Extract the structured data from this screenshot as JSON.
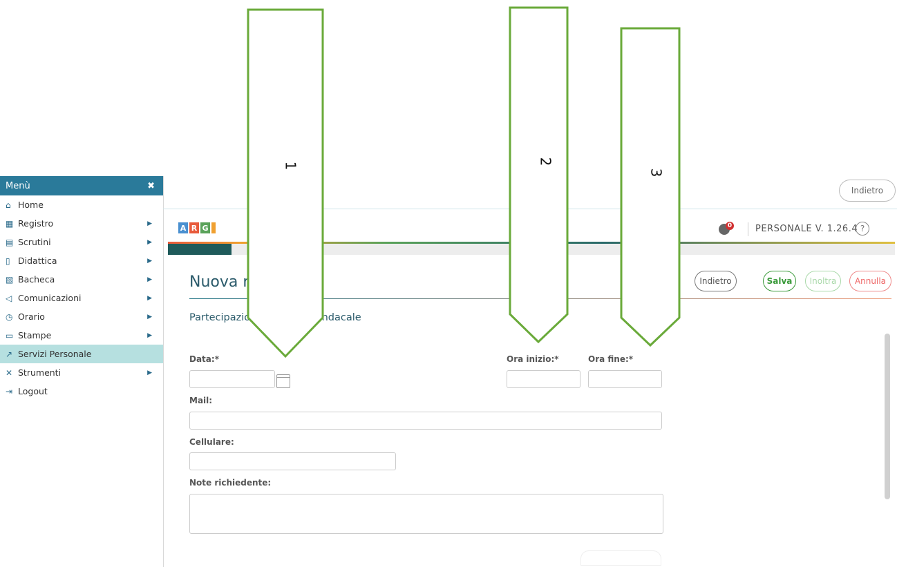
{
  "sidebar": {
    "title": "Menù",
    "close_icon": "close-icon",
    "items": [
      {
        "label": "Home",
        "icon": "home-icon",
        "arrow": false,
        "active": false
      },
      {
        "label": "Registro",
        "icon": "calendar-icon",
        "arrow": true,
        "active": false
      },
      {
        "label": "Scrutini",
        "icon": "document-icon",
        "arrow": true,
        "active": false
      },
      {
        "label": "Didattica",
        "icon": "book-icon",
        "arrow": true,
        "active": false
      },
      {
        "label": "Bacheca",
        "icon": "board-icon",
        "arrow": true,
        "active": false
      },
      {
        "label": "Comunicazioni",
        "icon": "megaphone-icon",
        "arrow": true,
        "active": false
      },
      {
        "label": "Orario",
        "icon": "clock-icon",
        "arrow": true,
        "active": false
      },
      {
        "label": "Stampe",
        "icon": "printer-icon",
        "arrow": true,
        "active": false
      },
      {
        "label": "Servizi Personale",
        "icon": "external-link-icon",
        "arrow": false,
        "active": true
      },
      {
        "label": "Strumenti",
        "icon": "tools-icon",
        "arrow": true,
        "active": false
      },
      {
        "label": "Logout",
        "icon": "logout-icon",
        "arrow": false,
        "active": false
      }
    ]
  },
  "header": {
    "back_top_label": "Indietro",
    "brand_letters": [
      "A",
      "R",
      "G"
    ],
    "notification_count": "0",
    "version": "PERSONALE V. 1.26.4",
    "help": "?"
  },
  "page": {
    "title": "Nuova ri",
    "subtitle_start": "Partecipazio",
    "subtitle_end": "sindacale"
  },
  "actions": {
    "indietro": "Indietro",
    "salva": "Salva",
    "inoltra": "Inoltra",
    "annulla": "Annulla"
  },
  "form": {
    "data_label": "Data:*",
    "ora_inizio_label": "Ora inizio:*",
    "ora_fine_label": "Ora fine:*",
    "mail_label": "Mail:",
    "cellulare_label": "Cellulare:",
    "note_label": "Note richiedente:"
  },
  "annotations": [
    "1",
    "2",
    "3"
  ],
  "colors": {
    "sidebar_header": "#2a7a9a",
    "active_item": "#b6e0e0",
    "arrow_stroke": "#6aaa3a"
  }
}
